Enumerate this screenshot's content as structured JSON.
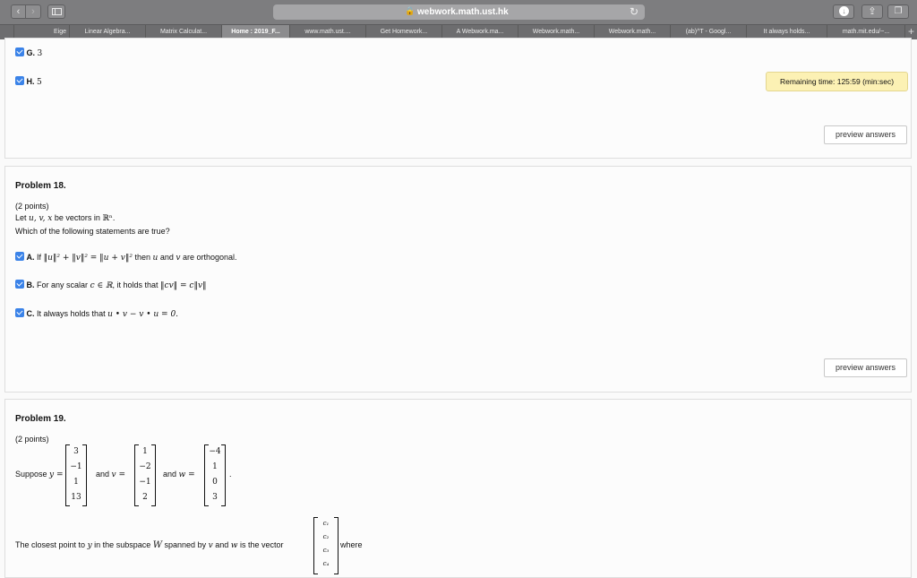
{
  "browser": {
    "url": "webwork.math.ust.hk",
    "tabs": [
      {
        "label": "Eige",
        "active": false
      },
      {
        "label": "Linear Algebra...",
        "active": false
      },
      {
        "label": "Matrix Calculat...",
        "active": false
      },
      {
        "label": "Home : 2019_F...",
        "active": true
      },
      {
        "label": "www.math.ust....",
        "active": false
      },
      {
        "label": "Get Homework...",
        "active": false
      },
      {
        "label": "A Webwork.ma...",
        "active": false
      },
      {
        "label": "Webwork.math...",
        "active": false
      },
      {
        "label": "Webwork.math...",
        "active": false
      },
      {
        "label": "(ab)^T - Googl...",
        "active": false
      },
      {
        "label": "It always holds...",
        "active": false
      },
      {
        "label": "math.mit.edu/~...",
        "active": false
      }
    ]
  },
  "timer": "Remaining time: 125:59 (min:sec)",
  "prev_options": [
    {
      "letter": "G.",
      "text": "3",
      "checked": true
    },
    {
      "letter": "H.",
      "text": "5",
      "checked": true
    }
  ],
  "preview_label": "preview answers",
  "problem18": {
    "title": "Problem 18.",
    "points": "(2 points)",
    "line1_pre": "Let",
    "line1_vars": "u, v, x",
    "line1_mid": "be vectors in",
    "line1_space": "ℝⁿ",
    "line1_end": ".",
    "question": "Which of the following statements are true?",
    "optA": {
      "letter": "A.",
      "pre": "If",
      "math": "‖u‖² + ‖v‖² = ‖u + v‖²",
      "post": "then",
      "var1": "u",
      "and": "and",
      "var2": "v",
      "end": "are orthogonal."
    },
    "optB": {
      "letter": "B.",
      "pre": "For any scalar",
      "math": "c ∈ ℝ",
      "mid": ", it holds that",
      "math2": "‖cv‖ = c‖v‖"
    },
    "optC": {
      "letter": "C.",
      "pre": "It always holds that",
      "math": "u • v − v • u = 0."
    }
  },
  "problem19": {
    "title": "Problem 19.",
    "points": "(2 points)",
    "suppose": "Suppose",
    "y_label": "y =",
    "and1": "and",
    "v_label": "v =",
    "and2": "and",
    "w_label": "w =",
    "y": [
      "3",
      "−1",
      "1",
      "13"
    ],
    "v": [
      "1",
      "−2",
      "−1",
      "2"
    ],
    "w": [
      "−4",
      "1",
      "0",
      "3"
    ],
    "period": ".",
    "closest_pre": "The closest point to",
    "closest_y": "y",
    "closest_mid": "in the subspace",
    "closest_W": "W",
    "closest_mid2": "spanned by",
    "closest_v": "v",
    "closest_and": "and",
    "closest_w": "w",
    "closest_post": "is the vector",
    "c_vector": [
      "c₁",
      "c₂",
      "c₃",
      "c₄"
    ],
    "where": "where"
  }
}
